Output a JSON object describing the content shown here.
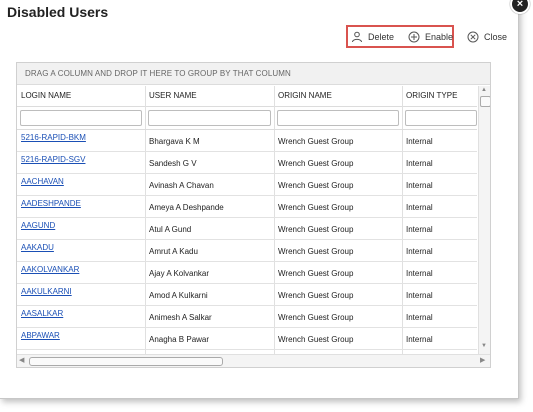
{
  "dialog": {
    "title": "Disabled Users",
    "close_glyph": "×"
  },
  "toolbar": {
    "delete_label": "Delete",
    "delete_icon": "user-icon",
    "enable_label": "Enable",
    "enable_icon": "plus-circle-icon",
    "close_label": "Close",
    "close_icon": "x-circle-icon",
    "highlight_color": "#d9534f"
  },
  "grid": {
    "group_hint": "DRAG A COLUMN AND DROP IT HERE TO GROUP BY THAT COLUMN",
    "columns": [
      "LOGIN NAME",
      "USER NAME",
      "ORIGIN NAME",
      "ORIGIN TYPE"
    ],
    "filters": [
      "",
      "",
      "",
      ""
    ],
    "rows": [
      {
        "login": "5216-RAPID-BKM",
        "user": "Bhargava K M",
        "origin": "Wrench Guest Group",
        "type": "Internal"
      },
      {
        "login": "5216-RAPID-SGV",
        "user": "Sandesh G V",
        "origin": "Wrench Guest Group",
        "type": "Internal"
      },
      {
        "login": "AACHAVAN",
        "user": "Avinash A Chavan",
        "origin": "Wrench Guest Group",
        "type": "Internal"
      },
      {
        "login": "AADESHPANDE",
        "user": "Ameya A Deshpande",
        "origin": "Wrench Guest Group",
        "type": "Internal"
      },
      {
        "login": "AAGUND",
        "user": "Atul A Gund",
        "origin": "Wrench Guest Group",
        "type": "Internal"
      },
      {
        "login": "AAKADU",
        "user": "Amrut A Kadu",
        "origin": "Wrench Guest Group",
        "type": "Internal"
      },
      {
        "login": "AAKOLVANKAR",
        "user": "Ajay A Kolvankar",
        "origin": "Wrench Guest Group",
        "type": "Internal"
      },
      {
        "login": "AAKULKARNI",
        "user": "Amod A Kulkarni",
        "origin": "Wrench Guest Group",
        "type": "Internal"
      },
      {
        "login": "AASALKAR",
        "user": "Animesh A Salkar",
        "origin": "Wrench Guest Group",
        "type": "Internal"
      },
      {
        "login": "ABPAWAR",
        "user": "Anagha B Pawar",
        "origin": "Wrench Guest Group",
        "type": "Internal"
      }
    ]
  },
  "colors": {
    "link": "#1a4fb5",
    "group_bar_bg": "#f1f1f1"
  }
}
